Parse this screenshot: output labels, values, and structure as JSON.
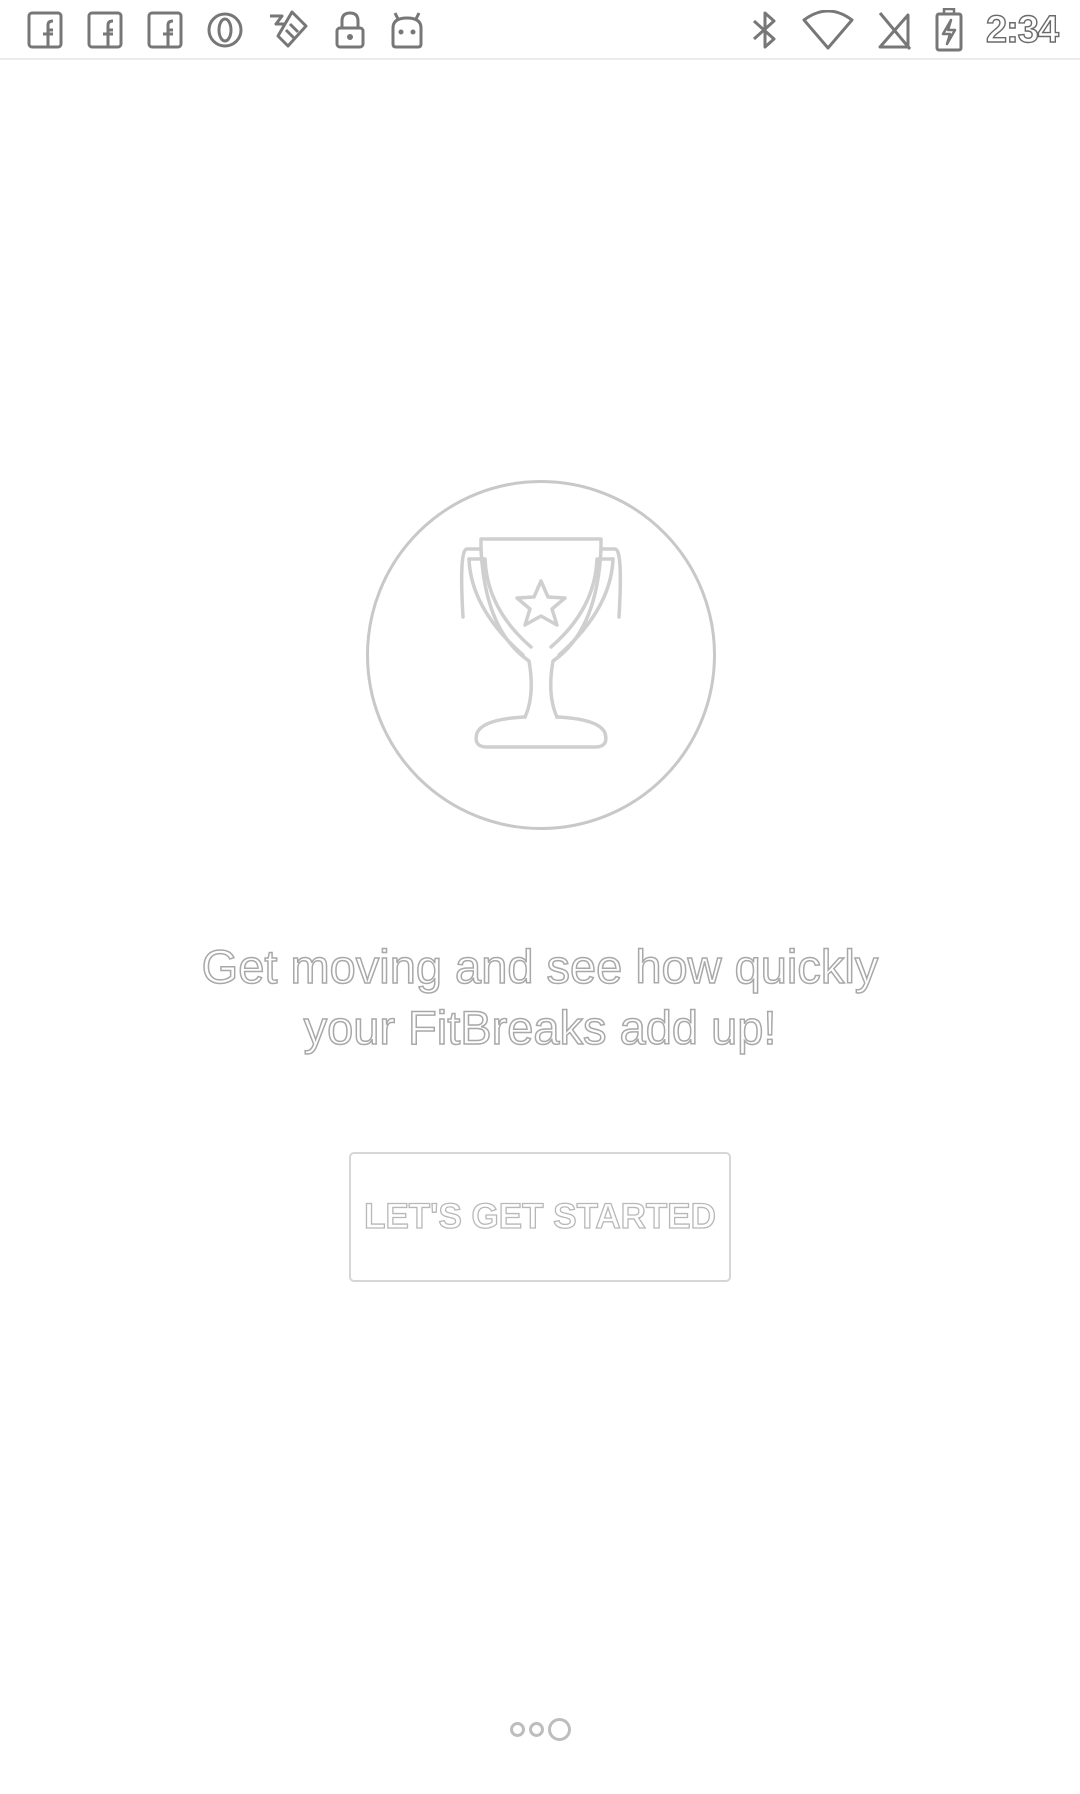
{
  "status_bar": {
    "time": "2:34",
    "notification_icons": [
      "facebook-icon",
      "facebook-icon",
      "facebook-icon",
      "opera-icon",
      "health-app-icon",
      "lock-icon",
      "android-icon"
    ],
    "system_icons": [
      "bluetooth-icon",
      "wifi-icon",
      "no-sim-icon",
      "battery-charging-icon"
    ]
  },
  "onboarding": {
    "icon": "trophy-icon",
    "message_line1": "Get moving and see how quickly",
    "message_line2": "your FitBreaks add up!",
    "button_label": "LET'S GET STARTED",
    "page_count": 3,
    "active_page": 3
  }
}
